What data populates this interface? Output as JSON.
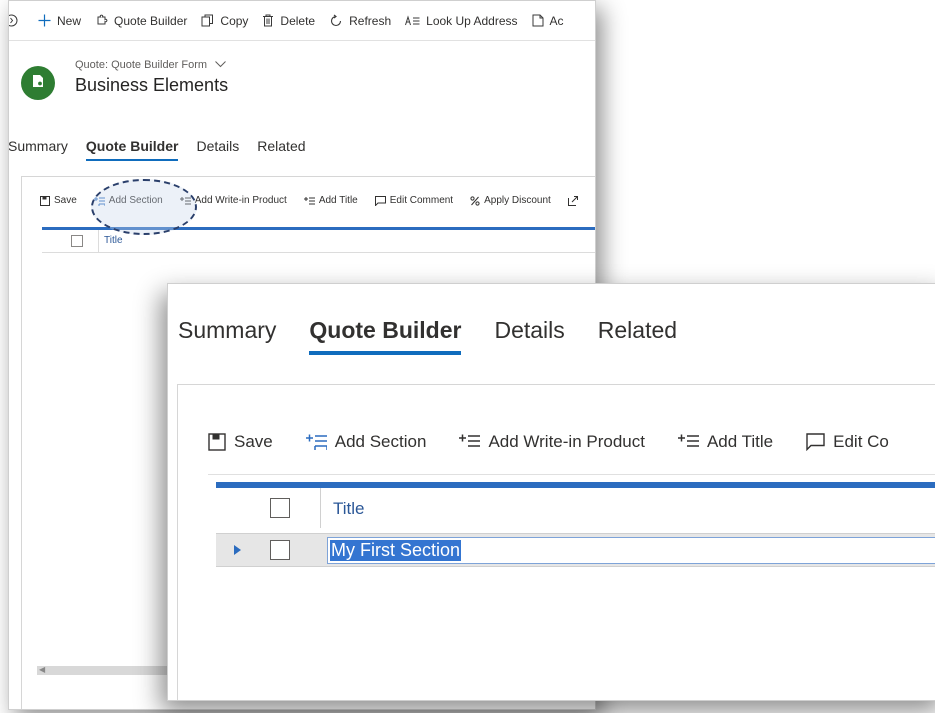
{
  "command_bar": {
    "items": [
      {
        "label": "",
        "icon": "history-icon"
      },
      {
        "label": "New",
        "icon": "plus-icon"
      },
      {
        "label": "Quote Builder",
        "icon": "puzzle-icon"
      },
      {
        "label": "Copy",
        "icon": "copy-icon"
      },
      {
        "label": "Delete",
        "icon": "trash-icon"
      },
      {
        "label": "Refresh",
        "icon": "refresh-icon"
      },
      {
        "label": "Look Up Address",
        "icon": "address-lookup-icon"
      },
      {
        "label": "Ac",
        "icon": "document-icon"
      }
    ]
  },
  "record": {
    "form_selector": "Quote: Quote Builder Form",
    "name": "Business Elements"
  },
  "tabs": [
    "Summary",
    "Quote Builder",
    "Details",
    "Related"
  ],
  "active_tab": "Quote Builder",
  "grid_toolbar_back": {
    "save": "Save",
    "add_section": "Add Section",
    "add_writein": "Add Write-in Product",
    "add_title": "Add Title",
    "edit_comment": "Edit Comment",
    "apply_discount": "Apply Discount"
  },
  "grid_toolbar_front": {
    "save": "Save",
    "add_section": "Add Section",
    "add_writein": "Add Write-in Product",
    "add_title": "Add Title",
    "edit_comment": "Edit Co"
  },
  "grid": {
    "column_title": "Title",
    "row_value": "My First Section"
  },
  "colors": {
    "accent": "#0f6cbd",
    "avatar": "#2e7d32",
    "selection": "#3475d1"
  }
}
